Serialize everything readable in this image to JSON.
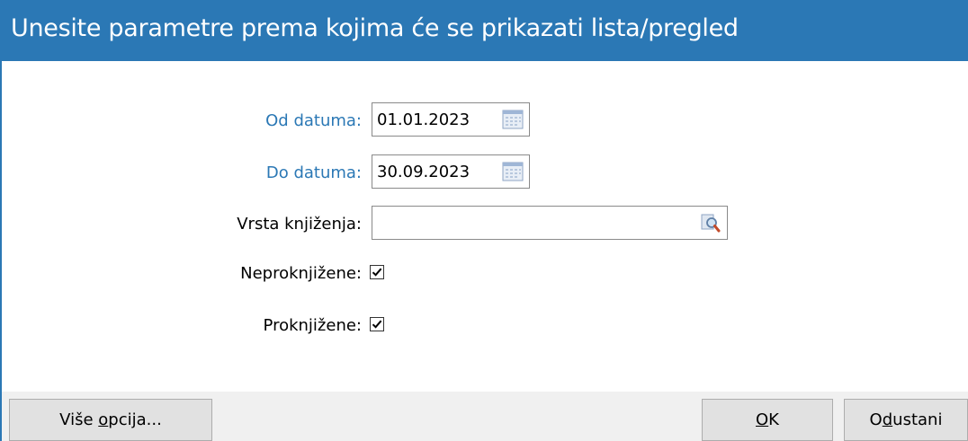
{
  "window": {
    "title": "Unesite parametre prema kojima će se prikazati lista/pregled"
  },
  "form": {
    "od_datuma": {
      "label": "Od datuma:",
      "value": "01.01.2023",
      "icon": "calendar-icon"
    },
    "do_datuma": {
      "label": "Do datuma:",
      "value": "30.09.2023",
      "icon": "calendar-icon"
    },
    "vrsta_knjizenja": {
      "label": "Vrsta knjiženja:",
      "value": "",
      "icon": "lookup-search-icon"
    },
    "neproknjizene": {
      "label": "Neproknjižene:",
      "checked": true
    },
    "proknjizene": {
      "label": "Proknjižene:",
      "checked": true
    }
  },
  "buttons": {
    "vise_opcija": {
      "before": "Više ",
      "mnemonic": "o",
      "after": "pcija..."
    },
    "ok": {
      "before": "",
      "mnemonic": "O",
      "after": "K"
    },
    "odustani": {
      "before": "O",
      "mnemonic": "d",
      "after": "ustani"
    }
  },
  "colors": {
    "accent": "#2b78b5",
    "footer": "#f0f0f0",
    "button": "#e1e1e1"
  }
}
